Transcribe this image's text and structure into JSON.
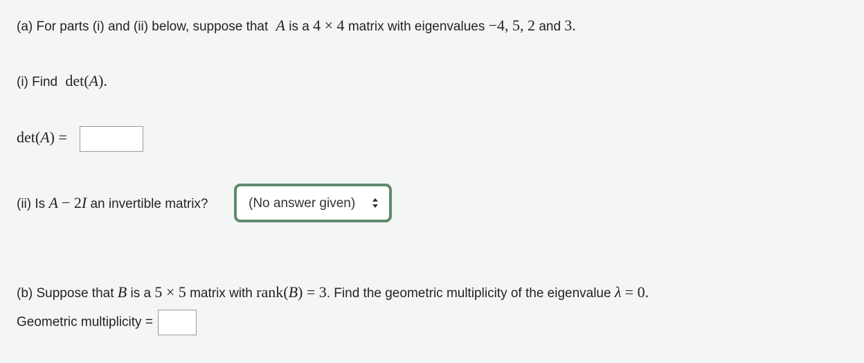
{
  "part_a": {
    "intro_prefix": "(a)  For parts (i) and (ii) below, suppose that",
    "intro_matrix": "A",
    "intro_mid": "is a",
    "intro_dims": "4 × 4",
    "intro_mid2": "matrix with eigenvalues",
    "intro_eigs": "−4, 5, 2",
    "intro_and": "and",
    "intro_last": "3."
  },
  "part_i": {
    "question_prefix": "(i) Find",
    "question_math_fn": "det(",
    "question_math_var": "A",
    "question_math_close": ").",
    "answer_label_fn": "det(",
    "answer_label_var": "A",
    "answer_label_close": ") =",
    "answer_value": ""
  },
  "part_ii": {
    "question_prefix": "(ii) Is",
    "question_math_a": "A",
    "question_math_minus": "−",
    "question_math_2": "2",
    "question_math_i": "I",
    "question_suffix": "an invertible matrix?",
    "select_value": "(No answer given)",
    "select_icon": "up-down-arrows-icon",
    "accent_color": "#5f8a6e"
  },
  "part_b": {
    "question_prefix": "(b) Suppose that",
    "question_matrix": "B",
    "question_mid": "is a",
    "question_dims": "5 × 5",
    "question_mid2": "matrix with",
    "question_rank_fn": "rank(",
    "question_rank_var": "B",
    "question_rank_close": ") = 3",
    "question_suffix": ". Find the geometric multiplicity of the eigenvalue",
    "question_lambda": "λ",
    "question_eq": "= 0.",
    "answer_label": "Geometric multiplicity =",
    "answer_value": ""
  }
}
